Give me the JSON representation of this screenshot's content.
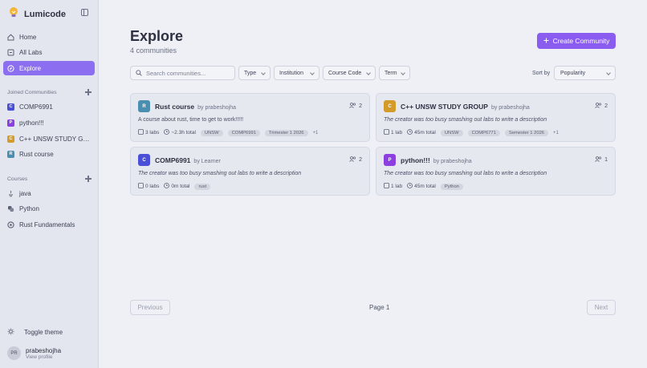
{
  "app": {
    "name": "Lumicode"
  },
  "nav": {
    "items": [
      {
        "label": "Home",
        "icon": "home-icon",
        "active": false
      },
      {
        "label": "All Labs",
        "icon": "labs-icon",
        "active": false
      },
      {
        "label": "Explore",
        "icon": "compass-icon",
        "active": true
      }
    ]
  },
  "joined": {
    "label": "Joined Communities",
    "items": [
      {
        "letter": "C",
        "label": "COMP6991",
        "color": "#4a4fd8"
      },
      {
        "letter": "P",
        "label": "python!!!",
        "color": "#8b3fe0"
      },
      {
        "letter": "C",
        "label": "C++ UNSW STUDY GROUP",
        "color": "#d49a2a"
      },
      {
        "letter": "R",
        "label": "Rust course",
        "color": "#4a8fb0"
      }
    ]
  },
  "courses": {
    "label": "Courses",
    "items": [
      {
        "label": "java",
        "icon": "java-icon"
      },
      {
        "label": "Python",
        "icon": "python-icon"
      },
      {
        "label": "Rust Fundamentals",
        "icon": "rust-icon"
      }
    ]
  },
  "footer": {
    "toggle_theme": "Toggle theme",
    "user": {
      "initials": "PR",
      "name": "prabeshojha",
      "link": "View profile"
    }
  },
  "main": {
    "title": "Explore",
    "subtitle": "4 communities",
    "create_label": "Create Community",
    "search_placeholder": "Search communities...",
    "filters": [
      "Type",
      "Institution",
      "Course Code",
      "Term"
    ],
    "sort_label": "Sort by",
    "sort_value": "Popularity"
  },
  "cards": [
    {
      "letter": "R",
      "color": "#4a8fb0",
      "title": "Rust course",
      "by": "by prabeshojha",
      "members": "2",
      "description": "A course about rust, time to get to work!!!!!",
      "italic": false,
      "labs": "3 labs",
      "time": "~2.3h total",
      "tags": [
        "UNSW",
        "COMP6991",
        "Trimester 1 2026"
      ],
      "more": "+1"
    },
    {
      "letter": "C",
      "color": "#d49a2a",
      "title": "C++ UNSW STUDY GROUP",
      "by": "by prabeshojha",
      "members": "2",
      "description": "The creator was too busy smashing out labs to write a description",
      "italic": true,
      "labs": "1 lab",
      "time": "45m total",
      "tags": [
        "UNSW",
        "COMP6771",
        "Semester 1 2026"
      ],
      "more": "+1"
    },
    {
      "letter": "C",
      "color": "#4a4fd8",
      "title": "COMP6991",
      "by": "by Learner",
      "members": "2",
      "description": "The creator was too busy smashing out labs to write a description",
      "italic": true,
      "labs": "0 labs",
      "time": "0m total",
      "tags": [
        "rust"
      ],
      "more": ""
    },
    {
      "letter": "P",
      "color": "#8b3fe0",
      "title": "python!!!",
      "by": "by prabeshojha",
      "members": "1",
      "description": "The creator was too busy smashing out labs to write a description",
      "italic": true,
      "labs": "1 lab",
      "time": "45m total",
      "tags": [
        "Python"
      ],
      "more": ""
    }
  ],
  "pagination": {
    "previous": "Previous",
    "page": "Page 1",
    "next": "Next"
  }
}
